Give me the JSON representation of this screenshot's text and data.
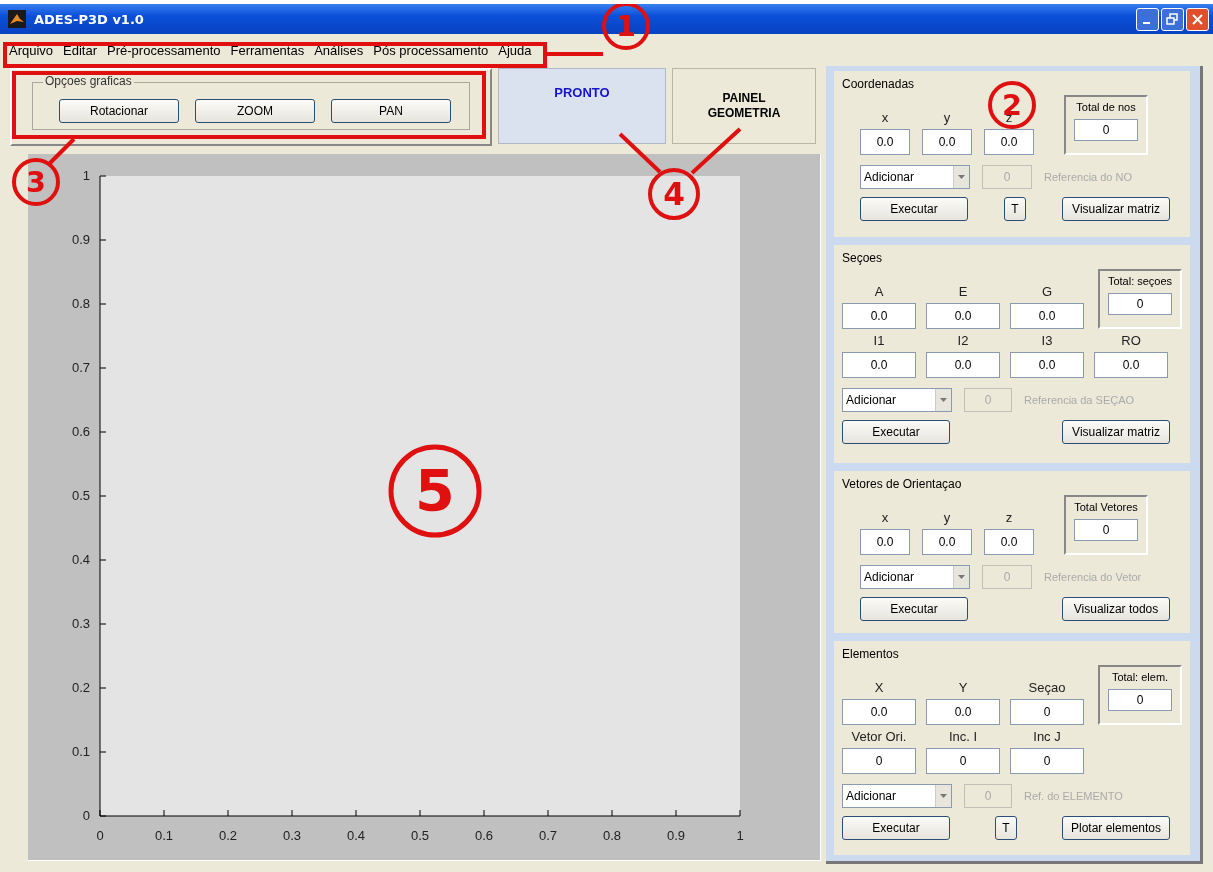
{
  "window": {
    "title": "ADES-P3D v1.0"
  },
  "menu": [
    "Arquivo",
    "Editar",
    "Pré-processamento",
    "Ferramentas",
    "Análises",
    "Pós processamento",
    "Ajuda"
  ],
  "graphics_options": {
    "title": "Opçoes graficas",
    "buttons": [
      "Rotacionar",
      "ZOOM",
      "PAN"
    ]
  },
  "status": {
    "text": "PRONTO"
  },
  "panel_button": {
    "label": "PAINEL\nGEOMETRIA"
  },
  "plot": {
    "chart_data": {
      "type": "line",
      "xlim": [
        0,
        1
      ],
      "ylim": [
        0,
        1
      ],
      "xticks": [
        0,
        0.1,
        0.2,
        0.3,
        0.4,
        0.5,
        0.6,
        0.7,
        0.8,
        0.9,
        1
      ],
      "yticks": [
        0,
        0.1,
        0.2,
        0.3,
        0.4,
        0.5,
        0.6,
        0.7,
        0.8,
        0.9,
        1
      ]
    }
  },
  "sections": [
    {
      "title": "Coordenadas",
      "field_rows": [
        [
          {
            "label": "x",
            "value": "0.0"
          },
          {
            "label": "y",
            "value": "0.0"
          },
          {
            "label": "z",
            "value": "0.0"
          }
        ]
      ],
      "total": {
        "label": "Total de nos",
        "value": "0"
      },
      "action": "Adicionar",
      "reference": {
        "value": "0",
        "label": "Referencia do NO",
        "disabled": true
      },
      "buttons": [
        {
          "label": "Executar",
          "kind": "wide"
        },
        {
          "label": "T",
          "kind": "small"
        },
        {
          "label": "Visualizar matriz",
          "kind": "wide"
        }
      ]
    },
    {
      "title": "Seçoes",
      "field_rows": [
        [
          {
            "label": "A",
            "value": "0.0"
          },
          {
            "label": "E",
            "value": "0.0"
          },
          {
            "label": "G",
            "value": "0.0"
          }
        ],
        [
          {
            "label": "I1",
            "value": "0.0"
          },
          {
            "label": "I2",
            "value": "0.0"
          },
          {
            "label": "I3",
            "value": "0.0"
          },
          {
            "label": "RO",
            "value": "0.0"
          }
        ]
      ],
      "total": {
        "label": "Total: seçoes",
        "value": "0"
      },
      "action": "Adicionar",
      "reference": {
        "value": "0",
        "label": "Referencia da SEÇAO",
        "disabled": true
      },
      "buttons": [
        {
          "label": "Executar",
          "kind": "wide"
        },
        {
          "label": "Visualizar matriz",
          "kind": "wide"
        }
      ]
    },
    {
      "title": "Vetores de Orientaçao",
      "field_rows": [
        [
          {
            "label": "x",
            "value": "0.0"
          },
          {
            "label": "y",
            "value": "0.0"
          },
          {
            "label": "z",
            "value": "0.0"
          }
        ]
      ],
      "total": {
        "label": "Total Vetores",
        "value": "0"
      },
      "action": "Adicionar",
      "reference": {
        "value": "0",
        "label": "Referencia do Vetor",
        "disabled": true
      },
      "buttons": [
        {
          "label": "Executar",
          "kind": "wide"
        },
        {
          "label": "Visualizar todos",
          "kind": "wide"
        }
      ]
    },
    {
      "title": "Elementos",
      "field_rows": [
        [
          {
            "label": "X",
            "value": "0.0"
          },
          {
            "label": "Y",
            "value": "0.0"
          },
          {
            "label": "Seçao",
            "value": "0"
          }
        ],
        [
          {
            "label": "Vetor Ori.",
            "value": "0"
          },
          {
            "label": "Inc. I",
            "value": "0"
          },
          {
            "label": "Inc J",
            "value": "0"
          }
        ]
      ],
      "total": {
        "label": "Total: elem.",
        "value": "0"
      },
      "action": "Adicionar",
      "reference": {
        "value": "0",
        "label": "Ref. do ELEMENTO",
        "disabled": true
      },
      "buttons": [
        {
          "label": "Executar",
          "kind": "wide"
        },
        {
          "label": "T",
          "kind": "small"
        },
        {
          "label": "Plotar elementos",
          "kind": "wide"
        }
      ]
    }
  ],
  "annotations": [
    {
      "label": "1"
    },
    {
      "label": "2"
    },
    {
      "label": "3"
    },
    {
      "label": "4"
    },
    {
      "label": "5"
    }
  ]
}
